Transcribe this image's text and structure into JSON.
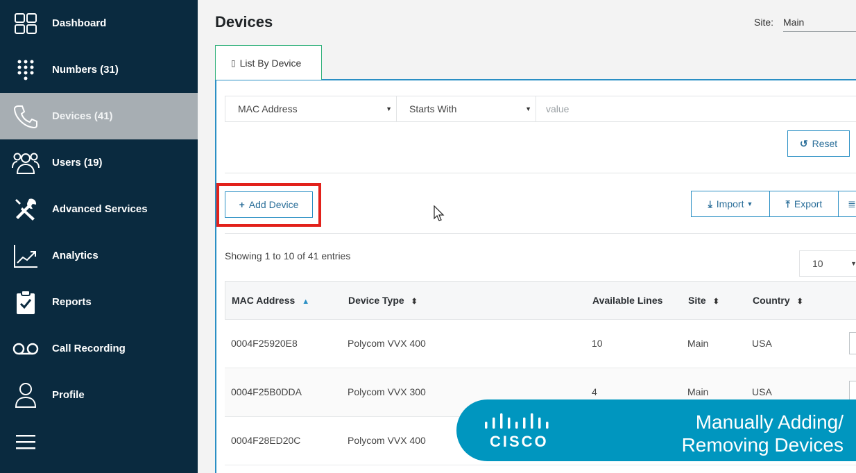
{
  "sidebar": {
    "items": [
      {
        "label": "Dashboard",
        "icon": "dashboard-grid-icon",
        "active": false
      },
      {
        "label": "Numbers (31)",
        "icon": "dialpad-icon",
        "active": false
      },
      {
        "label": "Devices (41)",
        "icon": "phone-handset-icon",
        "active": true
      },
      {
        "label": "Users (19)",
        "icon": "users-group-icon",
        "active": false
      },
      {
        "label": "Advanced Services",
        "icon": "tools-icon",
        "active": false
      },
      {
        "label": "Analytics",
        "icon": "analytics-chart-icon",
        "active": false
      },
      {
        "label": "Reports",
        "icon": "clipboard-check-icon",
        "active": false
      },
      {
        "label": "Call Recording",
        "icon": "voicemail-icon",
        "active": false
      },
      {
        "label": "Profile",
        "icon": "person-icon",
        "active": false
      }
    ],
    "menu_icon": "hamburger-menu-icon"
  },
  "header": {
    "title": "Devices",
    "site_label": "Site:",
    "site_value": "Main"
  },
  "tabs": [
    {
      "label": "List By Device",
      "icon": "device-icon",
      "active": true
    }
  ],
  "filter": {
    "field": "MAC Address",
    "operator": "Starts With",
    "value_placeholder": "value",
    "reset_label": "Reset"
  },
  "toolbar": {
    "add_device_label": "Add Device",
    "import_label": "Import",
    "export_label": "Export"
  },
  "table": {
    "entries_text": "Showing 1 to 10 of 41 entries",
    "page_size": "10",
    "columns": [
      "MAC Address",
      "Device Type",
      "Available Lines",
      "Site",
      "Country"
    ],
    "rows": [
      {
        "mac": "0004F25920E8",
        "type": "Polycom VVX 400",
        "lines": "10",
        "site": "Main",
        "country": "USA"
      },
      {
        "mac": "0004F25B0DDA",
        "type": "Polycom VVX 300",
        "lines": "4",
        "site": "Main",
        "country": "USA"
      },
      {
        "mac": "0004F28ED20C",
        "type": "Polycom VVX 400",
        "lines": "",
        "site": "",
        "country": ""
      }
    ]
  },
  "banner": {
    "brand": "CISCO",
    "title_line1": "Manually Adding/",
    "title_line2": "Removing Devices"
  },
  "colors": {
    "sidebar_bg": "#0a2a3f",
    "active_item_bg": "#a7aeb3",
    "accent_blue": "#2a8fc4",
    "highlight_red": "#e2211b",
    "banner_bg": "#0096bf"
  }
}
